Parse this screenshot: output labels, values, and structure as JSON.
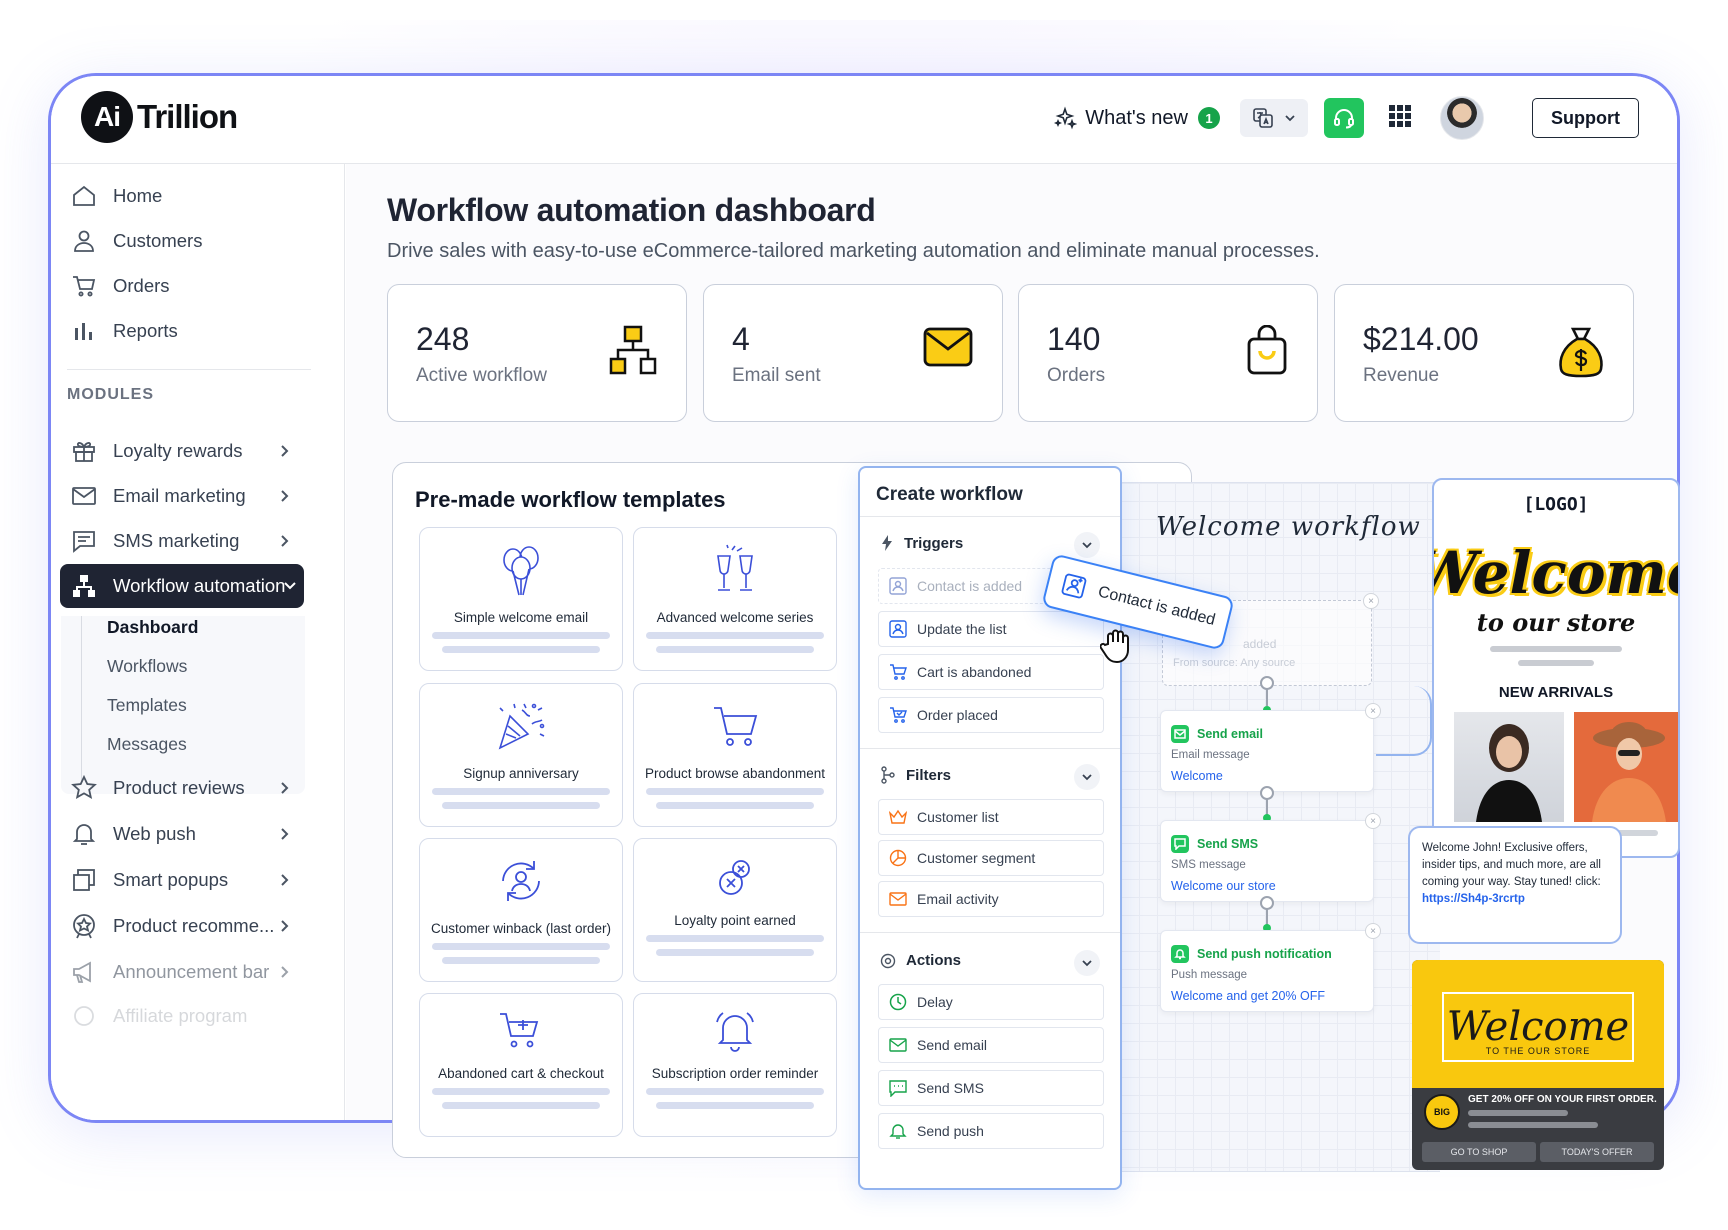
{
  "header": {
    "logo_mark": "Ai",
    "logo_text": "Trillion",
    "whats_new": "What's new",
    "whats_new_count": "1",
    "support": "Support"
  },
  "sidebar": {
    "items": [
      {
        "label": "Home"
      },
      {
        "label": "Customers"
      },
      {
        "label": "Orders"
      },
      {
        "label": "Reports"
      }
    ],
    "modules_heading": "MODULES",
    "modules": [
      {
        "label": "Loyalty rewards"
      },
      {
        "label": "Email marketing"
      },
      {
        "label": "SMS marketing"
      },
      {
        "label": "Workflow automation"
      },
      {
        "label": "Product reviews"
      },
      {
        "label": "Web push"
      },
      {
        "label": "Smart popups"
      },
      {
        "label": "Product recomme..."
      },
      {
        "label": "Announcement bar"
      },
      {
        "label": "Affiliate program"
      }
    ],
    "subitems": [
      {
        "label": "Dashboard"
      },
      {
        "label": "Workflows"
      },
      {
        "label": "Templates"
      },
      {
        "label": "Messages"
      }
    ]
  },
  "page": {
    "title": "Workflow automation dashboard",
    "subtitle": "Drive sales with easy-to-use eCommerce-tailored marketing automation and eliminate manual processes."
  },
  "stats": [
    {
      "value": "248",
      "label": "Active workflow"
    },
    {
      "value": "4",
      "label": "Email sent"
    },
    {
      "value": "140",
      "label": "Orders"
    },
    {
      "value": "$214.00",
      "label": "Revenue"
    }
  ],
  "templates": {
    "title": "Pre-made workflow templates",
    "items": [
      {
        "label": "Simple welcome email"
      },
      {
        "label": "Advanced welcome series"
      },
      {
        "label": "Signup anniversary"
      },
      {
        "label": "Product browse abandonment"
      },
      {
        "label": "Customer winback (last order)"
      },
      {
        "label": "Loyalty point earned"
      },
      {
        "label": "Abandoned cart & checkout"
      },
      {
        "label": "Subscription order reminder"
      }
    ]
  },
  "create_workflow": {
    "title": "Create workflow",
    "triggers_label": "Triggers",
    "triggers": [
      "Contact is added",
      "Update the list",
      "Cart is abandoned",
      "Order placed"
    ],
    "filters_label": "Filters",
    "filters": [
      "Customer list",
      "Customer segment",
      "Email activity"
    ],
    "actions_label": "Actions",
    "actions": [
      "Delay",
      "Send email",
      "Send SMS",
      "Send push"
    ],
    "dragging": "Contact is added"
  },
  "workflow": {
    "title": "Welcome workflow",
    "ghost_line1": "added",
    "ghost_line2": "From source: Any source",
    "nodes": [
      {
        "title": "Send email",
        "sub": "Email message",
        "value": "Welcome"
      },
      {
        "title": "Send SMS",
        "sub": "SMS message",
        "value": "Welcome our store"
      },
      {
        "title": "Send push notification",
        "sub": "Push message",
        "value": "Welcome and get 20% OFF"
      }
    ]
  },
  "email_preview": {
    "logo": "[LOGO]",
    "welcome": "Welcome",
    "tagline": "to our store",
    "new_arrivals": "NEW ARRIVALS"
  },
  "sms_preview": {
    "text": "Welcome John! Exclusive offers, insider tips, and much more, are all coming your way. Stay tuned!  click:",
    "link": "https://Sh4p-3rcrtp"
  },
  "push_preview": {
    "welcome": "Welcome",
    "sub": "TO THE OUR STORE",
    "badge": "BIG",
    "offer": "GET 20% OFF ON YOUR FIRST ORDER.",
    "btn1": "GO TO SHOP",
    "btn2": "TODAY'S OFFER"
  },
  "colors": {
    "accent": "#7c86f5",
    "green": "#22c55e",
    "dark": "#1f2433",
    "yellow": "#facc15"
  }
}
